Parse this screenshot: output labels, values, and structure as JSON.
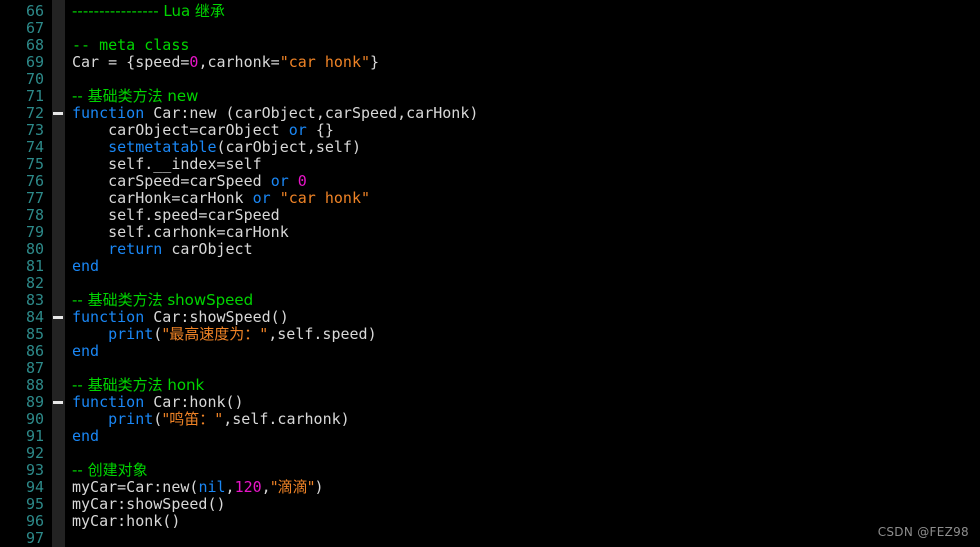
{
  "editor": {
    "language": "Lua",
    "first_line": 66,
    "last_line": 97,
    "colors": {
      "background": "#000000",
      "gutter_background": "#000000",
      "fold_column_background": "#232323",
      "line_number": "#2d8a8a",
      "default_text": "#d8d8d8",
      "comment": "#00d500",
      "keyword": "#1a87f5",
      "function": "#1a87f5",
      "string": "#ef8326",
      "number": "#e814c8",
      "fold_marker": "#e8e8e8",
      "watermark": "#8d8d8d"
    }
  },
  "watermark": {
    "text": "CSDN @FEZ98"
  },
  "lines": [
    {
      "num": "66",
      "fold": false,
      "tokens": [
        {
          "t": "comment",
          "v": "---------------- Lua 继承"
        }
      ]
    },
    {
      "num": "67",
      "fold": false,
      "tokens": []
    },
    {
      "num": "68",
      "fold": false,
      "tokens": [
        {
          "t": "comment",
          "v": "-- meta class"
        }
      ]
    },
    {
      "num": "69",
      "fold": false,
      "tokens": [
        {
          "t": "plain",
          "v": "Car = {speed="
        },
        {
          "t": "number",
          "v": "0"
        },
        {
          "t": "plain",
          "v": ",carhonk="
        },
        {
          "t": "string",
          "v": "\"car honk\""
        },
        {
          "t": "plain",
          "v": "}"
        }
      ]
    },
    {
      "num": "70",
      "fold": false,
      "tokens": []
    },
    {
      "num": "71",
      "fold": false,
      "tokens": [
        {
          "t": "comment",
          "v": "-- 基础类方法 new"
        }
      ]
    },
    {
      "num": "72",
      "fold": true,
      "tokens": [
        {
          "t": "keyword",
          "v": "function"
        },
        {
          "t": "plain",
          "v": " Car:new (carObject,carSpeed,carHonk)"
        }
      ]
    },
    {
      "num": "73",
      "fold": false,
      "tokens": [
        {
          "t": "plain",
          "v": "    carObject=carObject "
        },
        {
          "t": "keyword",
          "v": "or"
        },
        {
          "t": "plain",
          "v": " {}"
        }
      ]
    },
    {
      "num": "74",
      "fold": false,
      "tokens": [
        {
          "t": "plain",
          "v": "    "
        },
        {
          "t": "func",
          "v": "setmetatable"
        },
        {
          "t": "plain",
          "v": "(carObject,self)"
        }
      ]
    },
    {
      "num": "75",
      "fold": false,
      "tokens": [
        {
          "t": "plain",
          "v": "    self.__index=self"
        }
      ]
    },
    {
      "num": "76",
      "fold": false,
      "tokens": [
        {
          "t": "plain",
          "v": "    carSpeed=carSpeed "
        },
        {
          "t": "keyword",
          "v": "or"
        },
        {
          "t": "plain",
          "v": " "
        },
        {
          "t": "number",
          "v": "0"
        }
      ]
    },
    {
      "num": "77",
      "fold": false,
      "tokens": [
        {
          "t": "plain",
          "v": "    carHonk=carHonk "
        },
        {
          "t": "keyword",
          "v": "or"
        },
        {
          "t": "plain",
          "v": " "
        },
        {
          "t": "string",
          "v": "\"car honk\""
        }
      ]
    },
    {
      "num": "78",
      "fold": false,
      "tokens": [
        {
          "t": "plain",
          "v": "    self.speed=carSpeed"
        }
      ]
    },
    {
      "num": "79",
      "fold": false,
      "tokens": [
        {
          "t": "plain",
          "v": "    self.carhonk=carHonk"
        }
      ]
    },
    {
      "num": "80",
      "fold": false,
      "tokens": [
        {
          "t": "plain",
          "v": "    "
        },
        {
          "t": "keyword",
          "v": "return"
        },
        {
          "t": "plain",
          "v": " carObject"
        }
      ]
    },
    {
      "num": "81",
      "fold": false,
      "tokens": [
        {
          "t": "keyword",
          "v": "end"
        }
      ]
    },
    {
      "num": "82",
      "fold": false,
      "tokens": []
    },
    {
      "num": "83",
      "fold": false,
      "tokens": [
        {
          "t": "comment",
          "v": "-- 基础类方法 showSpeed"
        }
      ]
    },
    {
      "num": "84",
      "fold": true,
      "tokens": [
        {
          "t": "keyword",
          "v": "function"
        },
        {
          "t": "plain",
          "v": " Car:showSpeed()"
        }
      ]
    },
    {
      "num": "85",
      "fold": false,
      "tokens": [
        {
          "t": "plain",
          "v": "    "
        },
        {
          "t": "func",
          "v": "print"
        },
        {
          "t": "plain",
          "v": "("
        },
        {
          "t": "string",
          "v": "\"最高速度为："
        },
        {
          "t": "string",
          "v": "\""
        },
        {
          "t": "plain",
          "v": ",self.speed)"
        }
      ]
    },
    {
      "num": "86",
      "fold": false,
      "tokens": [
        {
          "t": "keyword",
          "v": "end"
        }
      ]
    },
    {
      "num": "87",
      "fold": false,
      "tokens": []
    },
    {
      "num": "88",
      "fold": false,
      "tokens": [
        {
          "t": "comment",
          "v": "-- 基础类方法 honk"
        }
      ]
    },
    {
      "num": "89",
      "fold": true,
      "tokens": [
        {
          "t": "keyword",
          "v": "function"
        },
        {
          "t": "plain",
          "v": " Car:honk()"
        }
      ]
    },
    {
      "num": "90",
      "fold": false,
      "tokens": [
        {
          "t": "plain",
          "v": "    "
        },
        {
          "t": "func",
          "v": "print"
        },
        {
          "t": "plain",
          "v": "("
        },
        {
          "t": "string",
          "v": "\"鸣笛："
        },
        {
          "t": "string",
          "v": "\""
        },
        {
          "t": "plain",
          "v": ",self.carhonk)"
        }
      ]
    },
    {
      "num": "91",
      "fold": false,
      "tokens": [
        {
          "t": "keyword",
          "v": "end"
        }
      ]
    },
    {
      "num": "92",
      "fold": false,
      "tokens": []
    },
    {
      "num": "93",
      "fold": false,
      "tokens": [
        {
          "t": "comment",
          "v": "-- 创建对象"
        }
      ]
    },
    {
      "num": "94",
      "fold": false,
      "tokens": [
        {
          "t": "plain",
          "v": "myCar=Car:new("
        },
        {
          "t": "keyword",
          "v": "nil"
        },
        {
          "t": "plain",
          "v": ","
        },
        {
          "t": "number",
          "v": "120"
        },
        {
          "t": "plain",
          "v": ","
        },
        {
          "t": "string",
          "v": "\"滴滴\""
        },
        {
          "t": "plain",
          "v": ")"
        }
      ]
    },
    {
      "num": "95",
      "fold": false,
      "tokens": [
        {
          "t": "plain",
          "v": "myCar:showSpeed()"
        }
      ]
    },
    {
      "num": "96",
      "fold": false,
      "tokens": [
        {
          "t": "plain",
          "v": "myCar:honk()"
        }
      ]
    },
    {
      "num": "97",
      "fold": false,
      "tokens": []
    }
  ]
}
